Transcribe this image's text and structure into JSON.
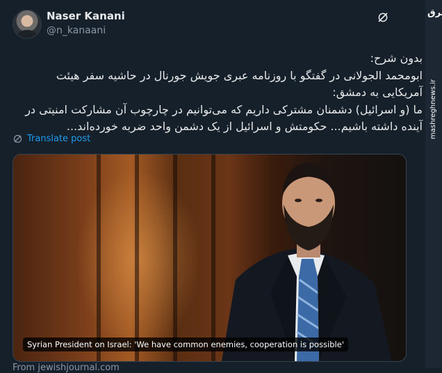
{
  "author": {
    "name": "Naser Kanani",
    "handle": "@n_kanaani"
  },
  "tweet": {
    "text": "بدون شرح:\nابومحمد الجولانی در گفتگو با روزنامه عبری جویش جورنال در حاشیه سفر هیئت آمریکایی به دمشق:\nما (و اسرائیل) دشمنان مشترکی داریم که می‌توانیم در چارچوب آن مشارکت امنیتی در آینده داشته باشیم... حکومتش و اسرائیل از یک دشمن واحد ضربه خورده‌اند...",
    "translate_label": "Translate post"
  },
  "media": {
    "caption": "Syrian President on Israel: 'We have common enemies, cooperation is possible'",
    "source": "From jewishjournal.com"
  },
  "watermark": {
    "logo": "مشرق",
    "url": "mashreghnews.ir"
  },
  "colors": {
    "background": "#16202a",
    "text": "#e7e9ea",
    "muted": "#8b98a5",
    "link": "#1d9bf0"
  },
  "icons": {
    "grok": "grok-icon",
    "translate": "globe-translate-icon"
  }
}
